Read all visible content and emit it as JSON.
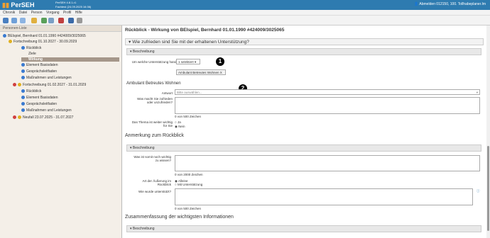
{
  "app": {
    "name": "PerSEH",
    "version_line1": "PerSEH 4.8.1-r1",
    "version_line2": "Fachtest (24.09.2025 16:36)",
    "user": "Abmelden 012150, 100. Tollhabeplaner.Im"
  },
  "menu": [
    "Chronik",
    "Datei",
    "Person",
    "Vorgang",
    "Profil",
    "Hilfe"
  ],
  "left": {
    "title": "Personen-Liste",
    "items": [
      {
        "label": "BEIspiel, Bernhard 01.01.1990 #424009/3025065"
      },
      {
        "label": "Fortschreibung 01.10.2027 - 30.09.2029"
      },
      {
        "label": "Rückblick"
      },
      {
        "label": "Ziele"
      },
      {
        "label": "Wirkung"
      },
      {
        "label": "Element Basisdaten"
      },
      {
        "label": "Gesprächsleitfaden"
      },
      {
        "label": "Maßnahmen und Leistungen"
      },
      {
        "label": "Fortschreibung 01.02.2027 - 31.01.2029"
      },
      {
        "label": "Rückblick"
      },
      {
        "label": "Element Basisdaten"
      },
      {
        "label": "Gesprächsleitfaden"
      },
      {
        "label": "Maßnahmen und Leistungen"
      },
      {
        "label": "Neufall 23.07.2025 - 31.07.2027"
      }
    ]
  },
  "main": {
    "heading": "Rückblick - Wirkung von  BEIspiel, Bernhard 01.01.1990 #424009/3025065",
    "question": "Wie zufrieden sind Sie mit der erhaltenen Unterstützung?",
    "section1": "Beschreibung",
    "support_label": "Um welche Unterstützung handelt es sich?",
    "support_value": "1 selektiert",
    "chip": "Ambulant Betreutes Wohnen",
    "chip_x": "X",
    "subheading": "Ambulant Betreutes Wohnen",
    "answer_label": "Antwort",
    "answer_placeholder": "Bitte auswählen...",
    "satisfied_label": "Was macht Sie zufrieden oder unzufrieden?",
    "counter1": "0 von 500 Zeichen",
    "topic_label": "Das Thema ist weiter wichtig für Sie",
    "opt_ja": "Ja",
    "opt_nein": "Nein",
    "annot_heading": "Anmerkung zum Rückblick",
    "section2": "Beschreibung",
    "important_label": "Was ist somit noch wichtig zu wissen?",
    "counter2": "0 von 2000 Zeichen",
    "kind_label": "Art der Äußerung im Rückblick",
    "opt_alleine": "Alleine",
    "opt_mit": "Mit Unterstützung",
    "supported_label": "Wie wurde unterstützt?",
    "counter3": "0 von 500 Zeichen",
    "summary_heading": "Zusammenfassung der wichtigsten Informationen",
    "section3": "Beschreibung",
    "marker1": "1",
    "marker2": "2"
  }
}
